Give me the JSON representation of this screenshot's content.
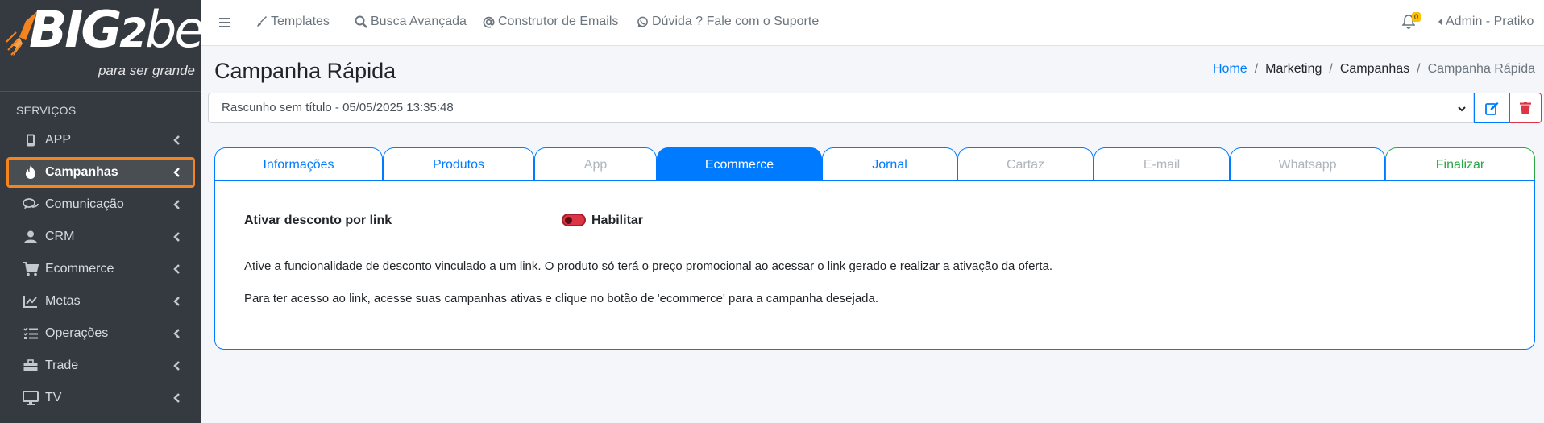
{
  "brand": {
    "logo_text_big": "BIG",
    "logo_text_two": "2",
    "logo_text_be": "be",
    "tagline": "para ser grande"
  },
  "sidebar": {
    "section_header": "SERVIÇOS",
    "items": [
      {
        "label": "APP",
        "icon": "mobile-icon"
      },
      {
        "label": "Campanhas",
        "icon": "fire-icon",
        "active": true
      },
      {
        "label": "Comunicação",
        "icon": "comments-icon"
      },
      {
        "label": "CRM",
        "icon": "user-icon"
      },
      {
        "label": "Ecommerce",
        "icon": "cart-icon"
      },
      {
        "label": "Metas",
        "icon": "chart-line-icon"
      },
      {
        "label": "Operações",
        "icon": "tasks-icon"
      },
      {
        "label": "Trade",
        "icon": "briefcase-icon"
      },
      {
        "label": "TV",
        "icon": "desktop-icon"
      }
    ]
  },
  "topbar": {
    "links": [
      {
        "label": "Templates",
        "icon": "brush-icon"
      },
      {
        "label": "Busca Avançada",
        "icon": "search-icon"
      },
      {
        "label": "Construtor de Emails",
        "icon": "at-icon"
      },
      {
        "label": "Dúvida ? Fale com o Suporte",
        "icon": "whatsapp-icon"
      }
    ],
    "notification_count": "0",
    "user_label": "Admin - Pratiko"
  },
  "page": {
    "title": "Campanha Rápida",
    "breadcrumb": [
      "Home",
      "Marketing",
      "Campanhas",
      "Campanha Rápida"
    ]
  },
  "draft": {
    "selected": "Rascunho sem título - 05/05/2025 13:35:48"
  },
  "tabs": [
    {
      "label": "Informações",
      "state": "enabled"
    },
    {
      "label": "Produtos",
      "state": "enabled"
    },
    {
      "label": "App",
      "state": "disabled"
    },
    {
      "label": "Ecommerce",
      "state": "active"
    },
    {
      "label": "Jornal",
      "state": "enabled"
    },
    {
      "label": "Cartaz",
      "state": "disabled"
    },
    {
      "label": "E-mail",
      "state": "disabled"
    },
    {
      "label": "Whatsapp",
      "state": "disabled"
    },
    {
      "label": "Finalizar",
      "state": "success"
    }
  ],
  "ecommerce": {
    "field_label": "Ativar desconto por link",
    "toggle_label": "Habilitar",
    "toggle_on": false,
    "description_1": "Ative a funcionalidade de desconto vinculado a um link. O produto só terá o preço promocional ao acessar o link gerado e realizar a ativação da oferta.",
    "description_2": "Para ter acesso ao link, acesse suas campanhas ativas e clique no botão de 'ecommerce' para a campanha desejada."
  },
  "colors": {
    "primary": "#007bff",
    "danger": "#dc3545",
    "success": "#28a745",
    "sidebar_bg": "#343a40",
    "active_outline": "#f5841f"
  }
}
